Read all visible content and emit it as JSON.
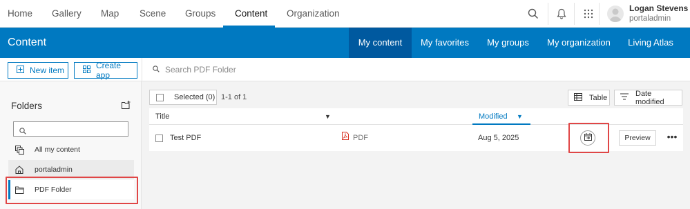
{
  "topnav": {
    "items": [
      "Home",
      "Gallery",
      "Map",
      "Scene",
      "Groups",
      "Content",
      "Organization"
    ],
    "active": "Content",
    "icons": [
      "search-icon",
      "bell-icon",
      "apps-grid-icon"
    ]
  },
  "user": {
    "name": "Logan Stevens",
    "login": "portaladmin"
  },
  "header": {
    "title": "Content",
    "tabs": [
      "My content",
      "My favorites",
      "My groups",
      "My organization",
      "Living Atlas"
    ],
    "active_tab": "My content"
  },
  "toolbar": {
    "new_item": "New item",
    "create_app": "Create app",
    "search_placeholder": "Search PDF Folder"
  },
  "sidebar": {
    "title": "Folders",
    "search_value": "",
    "items": [
      {
        "label": "All my content",
        "icon": "all-content-icon"
      },
      {
        "label": "portaladmin",
        "icon": "home-icon"
      },
      {
        "label": "PDF Folder",
        "icon": "folder-icon",
        "selected": true
      }
    ]
  },
  "content": {
    "selected_label": "Selected (0)",
    "count": "1-1 of 1",
    "view_label": "Table",
    "sort_label": "Date modified",
    "columns": {
      "title": "Title",
      "modified": "Modified"
    },
    "rows": [
      {
        "title": "Test PDF",
        "type": "PDF",
        "modified": "Aug 5, 2025",
        "action": "Preview"
      }
    ]
  },
  "colors": {
    "brand": "#0079c1",
    "brand_dark": "#00599f",
    "highlight": "#e04646",
    "pdf": "#d83020"
  }
}
